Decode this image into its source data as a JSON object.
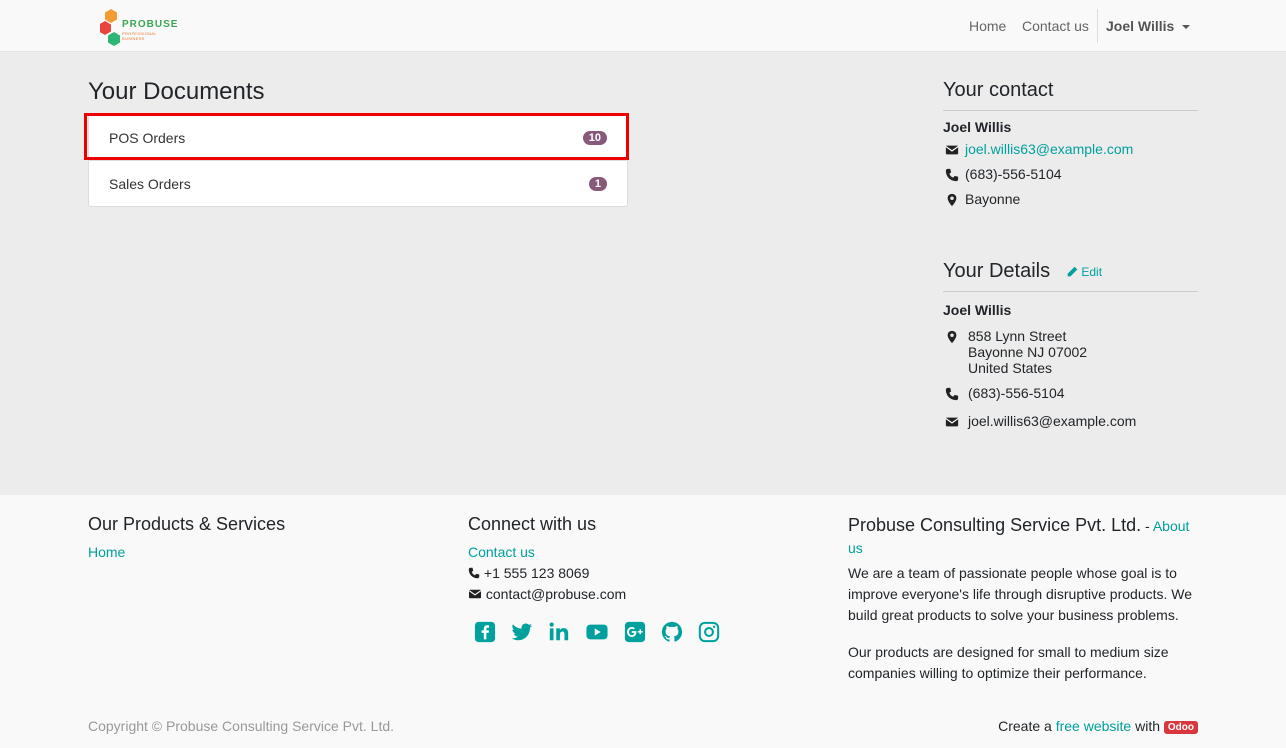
{
  "header": {
    "logo_text": "PROBUSE",
    "logo_sub": "PROFESSIONAL BUSINESS",
    "nav_home": "Home",
    "nav_contact": "Contact us",
    "user_name": "Joel Willis"
  },
  "documents": {
    "title": "Your Documents",
    "items": [
      {
        "label": "POS Orders",
        "count": "10"
      },
      {
        "label": "Sales Orders",
        "count": "1"
      }
    ]
  },
  "contact": {
    "title": "Your contact",
    "name": "Joel Willis",
    "email": "joel.willis63@example.com",
    "phone": "(683)-556-5104",
    "city": "Bayonne"
  },
  "details": {
    "title": "Your Details",
    "edit_label": "Edit",
    "name": "Joel Willis",
    "address_line1": "858 Lynn Street",
    "address_line2": "Bayonne NJ 07002",
    "address_line3": "United States",
    "phone": "(683)-556-5104",
    "email": "joel.willis63@example.com"
  },
  "footer": {
    "products_title": "Our Products & Services",
    "products_home": "Home",
    "connect_title": "Connect with us",
    "connect_contact": "Contact us",
    "connect_phone": "+1 555 123 8069",
    "connect_email": "contact@probuse.com",
    "company_title": "Probuse Consulting Service Pvt. Ltd.",
    "company_sep": " - ",
    "about_link": "About us",
    "para1": "We are a team of passionate people whose goal is to improve everyone's life through disruptive products. We build great products to solve your business problems.",
    "para2": "Our products are designed for small to medium size companies willing to optimize their performance.",
    "copyright": "Copyright © Probuse Consulting Service Pvt. Ltd.",
    "powered_prefix": "Create a ",
    "powered_link": "free website",
    "powered_with": " with ",
    "odoo": "Odoo"
  },
  "colors": {
    "accent": "#00a09d",
    "badge": "#875a7b",
    "highlight": "#e00000"
  },
  "icons": [
    "facebook-icon",
    "twitter-icon",
    "linkedin-icon",
    "youtube-icon",
    "google-plus-icon",
    "github-icon",
    "instagram-icon"
  ]
}
